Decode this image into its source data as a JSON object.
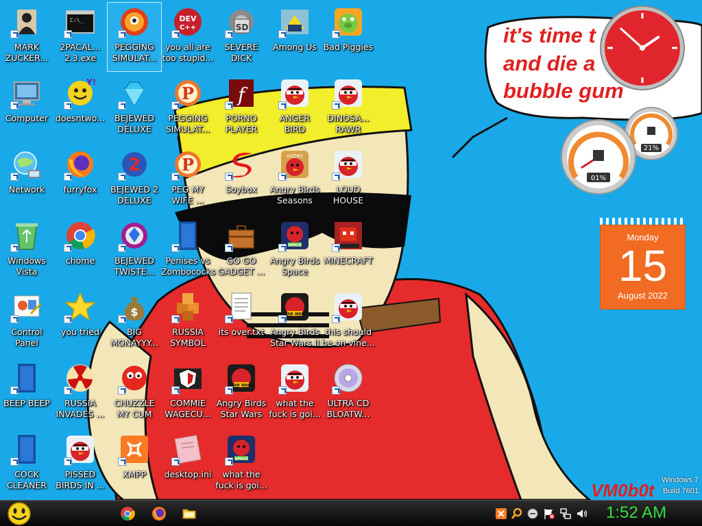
{
  "wallpaper": {
    "speech_bubble_text": [
      "it's time t",
      "and die a",
      "bubble gum"
    ]
  },
  "desktop_icons": [
    {
      "label": "MARK ZUCKER...",
      "icon": "person-icon"
    },
    {
      "label": "2PACAL... 2.3.exe",
      "icon": "console-icon"
    },
    {
      "label": "PEGGING SIMULAT...",
      "icon": "peg-ball-icon",
      "selected": true
    },
    {
      "label": "you all are too stupid...",
      "icon": "devcpp-icon"
    },
    {
      "label": "SEVERE DICK",
      "icon": "sd-card-icon"
    },
    {
      "label": "Among Us",
      "icon": "among-us-icon"
    },
    {
      "label": "Bad Piggies",
      "icon": "pig-icon"
    },
    {
      "label": "Computer",
      "icon": "computer-icon"
    },
    {
      "label": "doesntwo...",
      "icon": "yahoo-icon"
    },
    {
      "label": "BEJEWED DELUXE",
      "icon": "gem-icon"
    },
    {
      "label": "PEGGING SIMULAT...",
      "icon": "peg-p-icon"
    },
    {
      "label": "PORNO PLAYER",
      "icon": "flash-icon"
    },
    {
      "label": "ANGER BIRD",
      "icon": "angry-bird-icon"
    },
    {
      "label": "DINOSA... RAWR",
      "icon": "angry-bird-icon"
    },
    {
      "label": "Network",
      "icon": "globe-icon"
    },
    {
      "label": "furryfox",
      "icon": "firefox-icon"
    },
    {
      "label": "BEJEWED 2 DELUXE",
      "icon": "gem-2-icon"
    },
    {
      "label": "PEG MY WIFE ...",
      "icon": "peg-p-icon"
    },
    {
      "label": "Soybox",
      "icon": "s-logo-icon"
    },
    {
      "label": "Angry Birds Seasons",
      "icon": "angry-bird-seasons-icon"
    },
    {
      "label": "LOUD HOUSE",
      "icon": "angry-bird-icon"
    },
    {
      "label": "Windows Vista",
      "icon": "recycle-bin-icon"
    },
    {
      "label": "chome",
      "icon": "chrome-icon"
    },
    {
      "label": "BEJEWED TWISTE...",
      "icon": "gem-twist-icon"
    },
    {
      "label": "Penises vs Zombococks",
      "icon": "blank-file-icon"
    },
    {
      "label": "GO GO GADGET ...",
      "icon": "briefcase-icon"
    },
    {
      "label": "Angry Birds Space",
      "icon": "angry-bird-space-icon"
    },
    {
      "label": "MINECRAFT",
      "icon": "angry-bird-block-icon"
    },
    {
      "label": "Control Panel",
      "icon": "control-panel-icon"
    },
    {
      "label": "you tried",
      "icon": "star-icon"
    },
    {
      "label": "BIG MONAYYY...",
      "icon": "money-bag-icon"
    },
    {
      "label": "RUSSIA SYMBOL",
      "icon": "cubes-icon"
    },
    {
      "label": "its over.txt",
      "icon": "text-file-icon"
    },
    {
      "label": "Angry Birds Star Wars II",
      "icon": "angry-bird-starwars-icon"
    },
    {
      "label": "this should be on vine...",
      "icon": "angry-bird-icon"
    },
    {
      "label": "BEEP BEEP",
      "icon": "blank-file-icon"
    },
    {
      "label": "RUSSIA INVADES ...",
      "icon": "radiation-icon"
    },
    {
      "label": "CHUZZLE MY CUM",
      "icon": "chuzzle-icon"
    },
    {
      "label": "COMMIE WAGECU...",
      "icon": "shield-icon"
    },
    {
      "label": "Angry Birds Star Wars",
      "icon": "angry-bird-starwars-icon"
    },
    {
      "label": "what the fuck is goi...",
      "icon": "angry-bird-icon"
    },
    {
      "label": "ULTRA CD BLOATW...",
      "icon": "cd-icon"
    },
    {
      "label": "COCK CLEANER",
      "icon": "blank-file-icon"
    },
    {
      "label": "PISSED BIRDS IN ...",
      "icon": "angry-bird-icon"
    },
    {
      "label": "XMPP",
      "icon": "xampp-icon"
    },
    {
      "label": "desktop.ini",
      "icon": "ini-file-icon"
    },
    {
      "label": "what the fuck is goi...",
      "icon": "angry-bird-space-icon"
    }
  ],
  "gadgets": {
    "clock": {
      "hour": 1,
      "minute": 52
    },
    "cpu_meter": {
      "cpu_label": "01%",
      "memory_label": "21%"
    },
    "calendar": {
      "weekday": "Monday",
      "day": "15",
      "month_year": "August 2022"
    }
  },
  "watermark": {
    "text": "VM0b0t",
    "os_line1": "Windows 7",
    "os_line2": "Build 7601"
  },
  "taskbar": {
    "start_icon": "smiley-start-icon",
    "pinned": [
      "chrome-icon",
      "firefox-icon",
      "folder-icon"
    ],
    "tray_icons": [
      "xampp-icon",
      "search-icon",
      "circle-icon",
      "flag-icon",
      "network-icon",
      "volume-icon"
    ],
    "clock": "1:52 AM"
  },
  "colors": {
    "desktop_bg": "#1aa9e8",
    "taskbar_clock": "#32e03a",
    "calendar": "#f16b22"
  }
}
